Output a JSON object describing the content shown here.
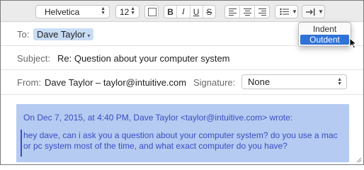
{
  "toolbar": {
    "font": "Helvetica",
    "size": "12",
    "style_buttons": [
      "B",
      "I",
      "U",
      "S"
    ]
  },
  "indent_menu": {
    "items": [
      "Indent",
      "Outdent"
    ],
    "highlighted": "Outdent"
  },
  "header": {
    "to_label": "To:",
    "to_value": "Dave Taylor",
    "subject_label": "Subject:",
    "subject_value": "Re: Question about your computer system",
    "from_label": "From:",
    "from_value": "Dave Taylor – taylor@intuitive.com",
    "signature_label": "Signature:",
    "signature_value": "None"
  },
  "body": {
    "quote_header": "On Dec 7, 2015, at 4:40 PM, Dave Taylor <taylor@intuitive.com> wrote:",
    "quote_text": "hey dave, can i ask you a question about your computer system? do you use a mac or pc system most of the time, and what exact computer do you have?"
  },
  "colors": {
    "selection": "#b5cbf1",
    "quote_text": "#3a4cc6",
    "menu_highlight": "#2f72d8"
  }
}
